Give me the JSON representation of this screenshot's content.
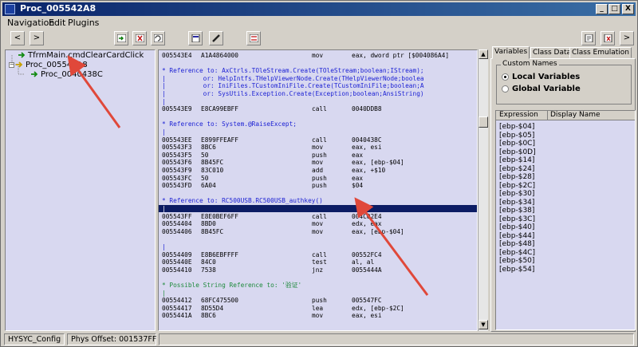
{
  "window": {
    "title": "Proc_005542A8",
    "controls": {
      "minimize": "_",
      "maximize": "□",
      "close": "X"
    }
  },
  "menu": [
    "Navigation",
    "Edit",
    "Plugins"
  ],
  "toolbar": {
    "back": "<",
    "forward": ">",
    "right_arrow": ">"
  },
  "tree": {
    "items": [
      "TfrmMain.cmdClearCardClick",
      "Proc_005542A8",
      "Proc_0040438C"
    ]
  },
  "code_lines": [
    {
      "kind": "asm",
      "addr": "005543E4",
      "bytes": "A1A4864000",
      "mnem": "mov",
      "ops": "eax, dword ptr [$004086A4]"
    },
    {
      "kind": "blank",
      "text": ""
    },
    {
      "kind": "ref",
      "text": "* Reference to: AxCtrls.TOleStream.Create(TOleStream;boolean;IStream);"
    },
    {
      "kind": "ref",
      "text": "|          or: HelpIntfs.THelpViewerNode.Create(THelpViewerNode;boolea"
    },
    {
      "kind": "ref",
      "text": "|          or: IniFiles.TCustomIniFile.Create(TCustomIniFile;boolean;A"
    },
    {
      "kind": "ref",
      "text": "|          or: SysUtils.Exception.Create(Exception;boolean;AnsiString)"
    },
    {
      "kind": "ref",
      "text": "|"
    },
    {
      "kind": "asm",
      "addr": "005543E9",
      "bytes": "E8CA99EBFF",
      "mnem": "call",
      "ops": "0040DDB8"
    },
    {
      "kind": "blank",
      "text": ""
    },
    {
      "kind": "ref",
      "text": "* Reference to: System.@RaiseExcept;"
    },
    {
      "kind": "ref",
      "text": "|"
    },
    {
      "kind": "asm",
      "addr": "005543EE",
      "bytes": "E899FFEAFF",
      "mnem": "call",
      "ops": "0040438C"
    },
    {
      "kind": "asm",
      "addr": "005543F3",
      "bytes": "8BC6",
      "mnem": "mov",
      "ops": "eax, esi"
    },
    {
      "kind": "asm",
      "addr": "005543F5",
      "bytes": "50",
      "mnem": "push",
      "ops": "eax"
    },
    {
      "kind": "asm",
      "addr": "005543F6",
      "bytes": "8B45FC",
      "mnem": "mov",
      "ops": "eax, [ebp-$04]"
    },
    {
      "kind": "asm",
      "addr": "005543F9",
      "bytes": "83C010",
      "mnem": "add",
      "ops": "eax, +$10"
    },
    {
      "kind": "asm",
      "addr": "005543FC",
      "bytes": "50",
      "mnem": "push",
      "ops": "eax"
    },
    {
      "kind": "asm",
      "addr": "005543FD",
      "bytes": "6A04",
      "mnem": "push",
      "ops": "$04"
    },
    {
      "kind": "blank",
      "text": ""
    },
    {
      "kind": "ref",
      "text": "* Reference to: RC500USB.RC500USB_authkey()"
    },
    {
      "kind": "sel",
      "text": "|"
    },
    {
      "kind": "asm",
      "addr": "005543FF",
      "bytes": "E8E0BEF6FF",
      "mnem": "call",
      "ops": "004C02E4"
    },
    {
      "kind": "asm",
      "addr": "00554404",
      "bytes": "8BD0",
      "mnem": "mov",
      "ops": "edx, eax"
    },
    {
      "kind": "asm",
      "addr": "00554406",
      "bytes": "8B45FC",
      "mnem": "mov",
      "ops": "eax, [ebp-$04]"
    },
    {
      "kind": "blank",
      "text": ""
    },
    {
      "kind": "ref",
      "text": "|"
    },
    {
      "kind": "asm",
      "addr": "00554409",
      "bytes": "E8B6EBFFFF",
      "mnem": "call",
      "ops": "00552FC4"
    },
    {
      "kind": "asm",
      "addr": "0055440E",
      "bytes": "84C0",
      "mnem": "test",
      "ops": "al, al"
    },
    {
      "kind": "asm",
      "addr": "00554410",
      "bytes": "7538",
      "mnem": "jnz",
      "ops": "0055444A"
    },
    {
      "kind": "blank",
      "text": ""
    },
    {
      "kind": "str",
      "text": "* Possible String Reference to: '验证'"
    },
    {
      "kind": "str",
      "text": "|"
    },
    {
      "kind": "asm",
      "addr": "00554412",
      "bytes": "68FC475500",
      "mnem": "push",
      "ops": "005547FC"
    },
    {
      "kind": "asm",
      "addr": "00554417",
      "bytes": "8D55D4",
      "mnem": "lea",
      "ops": "edx, [ebp-$2C]"
    },
    {
      "kind": "asm",
      "addr": "0055441A",
      "bytes": "8BC6",
      "mnem": "mov",
      "ops": "eax, esi"
    }
  ],
  "right_panel": {
    "tabs": [
      "Variables",
      "Class Data",
      "Class Emulation"
    ],
    "active_tab": "Variables",
    "custom_names_label": "Custom Names",
    "radios": [
      {
        "label": "Local Variables",
        "checked": true
      },
      {
        "label": "Global Variable",
        "checked": false
      }
    ],
    "columns": [
      "Expression",
      "Display Name"
    ],
    "expressions": [
      "[ebp-$04]",
      "[ebp-$05]",
      "[ebp-$0C]",
      "[ebp-$0D]",
      "[ebp-$14]",
      "[ebp-$24]",
      "[ebp-$28]",
      "[ebp-$2C]",
      "[ebp-$30]",
      "[ebp-$34]",
      "[ebp-$38]",
      "[ebp-$3C]",
      "[ebp-$40]",
      "[ebp-$44]",
      "[ebp-$48]",
      "[ebp-$4C]",
      "[ebp-$50]",
      "[ebp-$54]"
    ]
  },
  "status": {
    "config": "HYSYC_Config",
    "offset": "Phys Offset: 001537FF"
  },
  "colors": {
    "panel_bg": "#d8d8f0",
    "reference_text": "#1d22d4",
    "string_reference_text": "#1e8a3c",
    "selected_line": "#0c1c64",
    "annotation_arrow": "#e0483a"
  }
}
